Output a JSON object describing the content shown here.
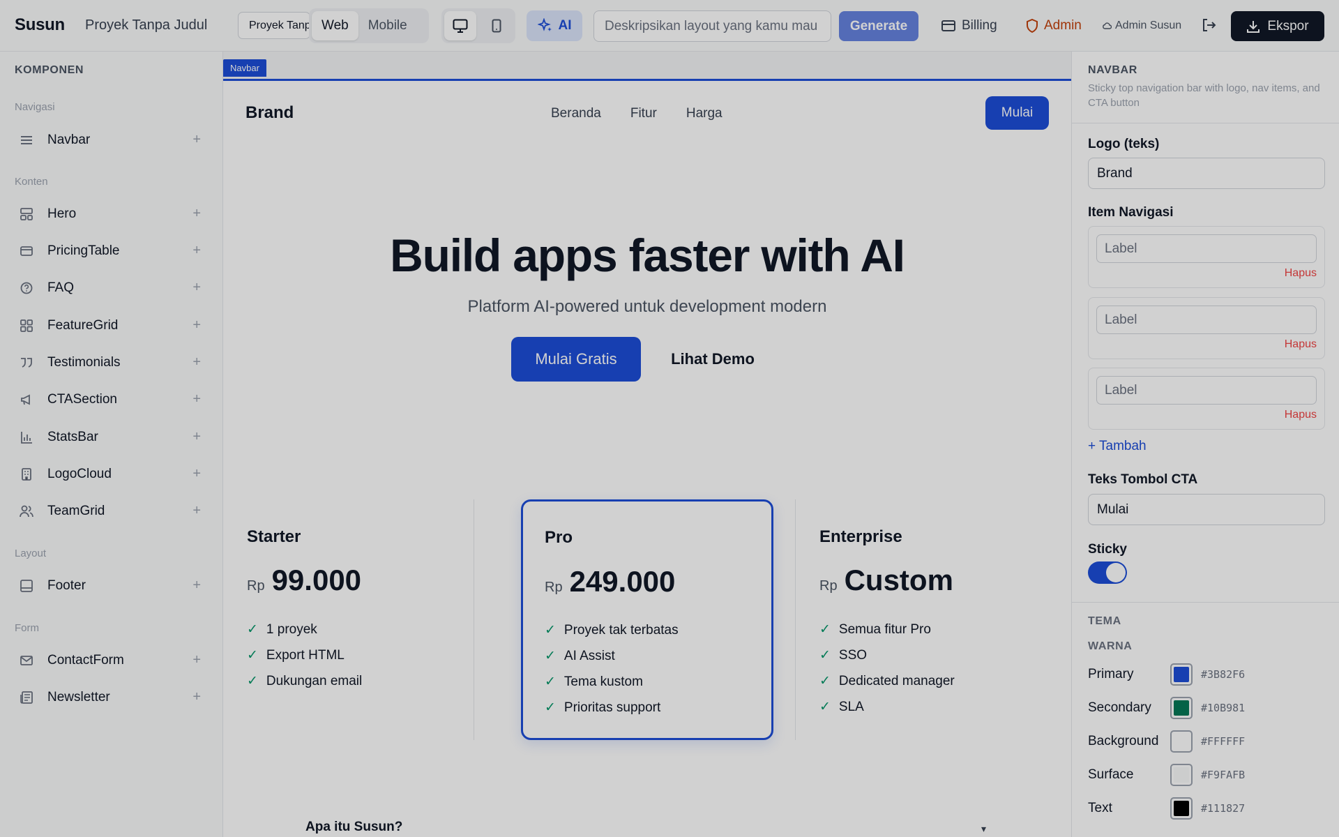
{
  "topbar": {
    "logo": "Susun",
    "title": "Proyek Tanpa Judul",
    "project_tab": "Proyek Tanpa Judul",
    "modes": [
      "Web",
      "Mobile"
    ],
    "active_mode": "Web",
    "devices": [
      "desktop-icon",
      "mobile-icon"
    ],
    "ai_label": "AI",
    "prompt_placeholder": "Deskripsikan layout yang kamu mau",
    "generate_label": "Generate",
    "billing_label": "Billing",
    "admin_label": "Admin",
    "user_label": "Admin Susun",
    "export_label": "Ekspor"
  },
  "sidebar": {
    "heading": "KOMPONEN",
    "groups": [
      {
        "label": "Navigasi",
        "items": [
          {
            "label": "Navbar",
            "icon": "menu-icon"
          }
        ]
      },
      {
        "label": "Konten",
        "items": [
          {
            "label": "Hero",
            "icon": "layout-icon"
          },
          {
            "label": "PricingTable",
            "icon": "card-icon"
          },
          {
            "label": "FAQ",
            "icon": "help-circle-icon"
          },
          {
            "label": "FeatureGrid",
            "icon": "grid-icon"
          },
          {
            "label": "Testimonials",
            "icon": "quote-icon"
          },
          {
            "label": "CTASection",
            "icon": "megaphone-icon"
          },
          {
            "label": "StatsBar",
            "icon": "bar-chart-icon"
          },
          {
            "label": "LogoCloud",
            "icon": "building-icon"
          },
          {
            "label": "TeamGrid",
            "icon": "users-icon"
          }
        ]
      },
      {
        "label": "Layout",
        "items": [
          {
            "label": "Footer",
            "icon": "footer-icon"
          }
        ]
      },
      {
        "label": "Form",
        "items": [
          {
            "label": "ContactForm",
            "icon": "mail-icon"
          },
          {
            "label": "Newsletter",
            "icon": "newspaper-icon"
          }
        ]
      }
    ]
  },
  "canvas": {
    "selected_tag": "Navbar",
    "navbar": {
      "brand": "Brand",
      "links": [
        "Beranda",
        "Fitur",
        "Harga"
      ],
      "cta": "Mulai"
    },
    "hero": {
      "title": "Build apps faster with AI",
      "subtitle": "Platform AI-powered untuk development modern",
      "primary_cta": "Mulai Gratis",
      "secondary_cta": "Lihat Demo"
    },
    "pricing": [
      {
        "name": "Starter",
        "currency": "Rp",
        "price": "99.000",
        "features": [
          "1 proyek",
          "Export HTML",
          "Dukungan email"
        ],
        "featured": false
      },
      {
        "name": "Pro",
        "currency": "Rp",
        "price": "249.000",
        "features": [
          "Proyek tak terbatas",
          "AI Assist",
          "Tema kustom",
          "Prioritas support"
        ],
        "featured": true
      },
      {
        "name": "Enterprise",
        "currency": "Rp",
        "price": "Custom",
        "features": [
          "Semua fitur Pro",
          "SSO",
          "Dedicated manager",
          "SLA"
        ],
        "featured": false
      }
    ],
    "faq_question": "Apa itu Susun?"
  },
  "panel": {
    "title": "NAVBAR",
    "description": "Sticky top navigation bar with logo, nav items, and CTA button",
    "logo_label": "Logo (teks)",
    "logo_value": "Brand",
    "nav_items_label": "Item Navigasi",
    "nav_items": [
      {
        "placeholder": "Label",
        "delete": "Hapus"
      },
      {
        "placeholder": "Label",
        "delete": "Hapus"
      },
      {
        "placeholder": "Label",
        "delete": "Hapus"
      }
    ],
    "add_label": "+ Tambah",
    "cta_label": "Teks Tombol CTA",
    "cta_value": "Mulai",
    "sticky_label": "Sticky",
    "sticky_on": true,
    "theme_heading": "TEMA",
    "color_heading": "WARNA",
    "colors": [
      {
        "name": "Primary",
        "hex": "#3B82F6",
        "swatch": "#1d4ed8"
      },
      {
        "name": "Secondary",
        "hex": "#10B981",
        "swatch": "#047857"
      },
      {
        "name": "Background",
        "hex": "#FFFFFF",
        "swatch": "#ffffff"
      },
      {
        "name": "Surface",
        "hex": "#F9FAFB",
        "swatch": "#f9fafb"
      },
      {
        "name": "Text",
        "hex": "#111827",
        "swatch": "#000000"
      }
    ]
  }
}
